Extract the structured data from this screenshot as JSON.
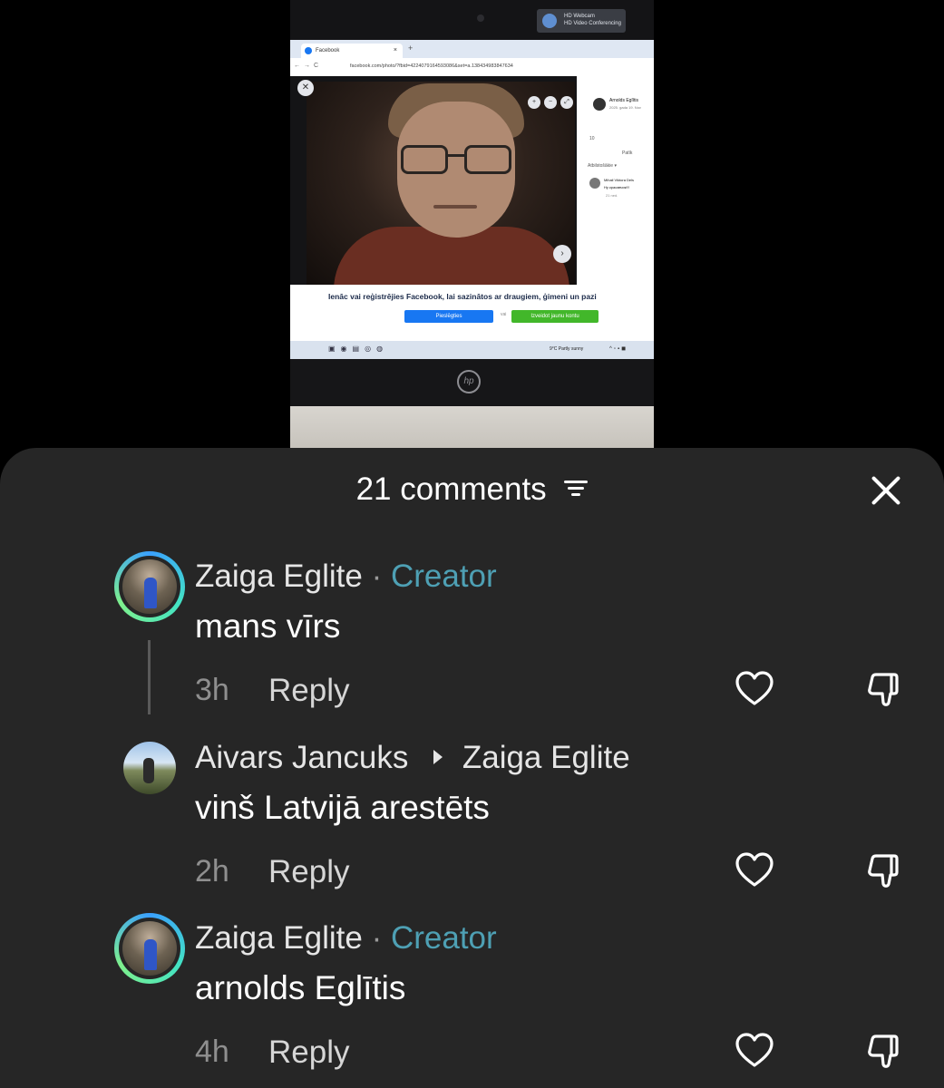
{
  "photo": {
    "webcam_label": "HD Webcam",
    "webcam_sub": "HD Video Conferencing",
    "browser_tab_title": "Facebook",
    "url": "facebook.com/photo/?fbid=4224079164593086&set=a.138434983847634",
    "poster_name": "Arnolds Eglītis",
    "poster_date": "2025. gada 19. Nov",
    "like_count": "10",
    "like_label": "Patīk",
    "relevance_label": "Atbilstošākie ▾",
    "commenter_name": "Mihail Viktora Dels",
    "comment_text": "Ну красавчик!!!",
    "comment_time": "21 ned.",
    "login_text": "Ienāc vai reģistrējies Facebook, lai sazinātos ar draugiem, ģimeni un pazi",
    "login_button": "Pieslēgties",
    "or_label": "vai",
    "register_button": "Izveidot jaunu kontu",
    "weather": "9°C  Partly sunny",
    "brand": "hp"
  },
  "sheet": {
    "title": "21 comments",
    "comments": [
      {
        "author": "Zaiga Eglite",
        "badge": "Creator",
        "text": "mans vīrs",
        "time": "3h",
        "reply_label": "Reply"
      },
      {
        "author": "Aivars Jancuks",
        "reply_to": "Zaiga Eglite",
        "text": "vinš Latvijā arestēts",
        "time": "2h",
        "reply_label": "Reply"
      },
      {
        "author": "Zaiga Eglite",
        "badge": "Creator",
        "text": "arnolds Eglītis",
        "time": "4h",
        "reply_label": "Reply"
      }
    ]
  },
  "icons": {
    "close": "close-icon",
    "sort": "sort-icon",
    "like": "heart-icon",
    "dislike": "dislike-icon"
  },
  "colors": {
    "sheet_bg": "#262626",
    "creator_badge": "#4ea0b4",
    "muted_text": "#8f8f8f"
  }
}
